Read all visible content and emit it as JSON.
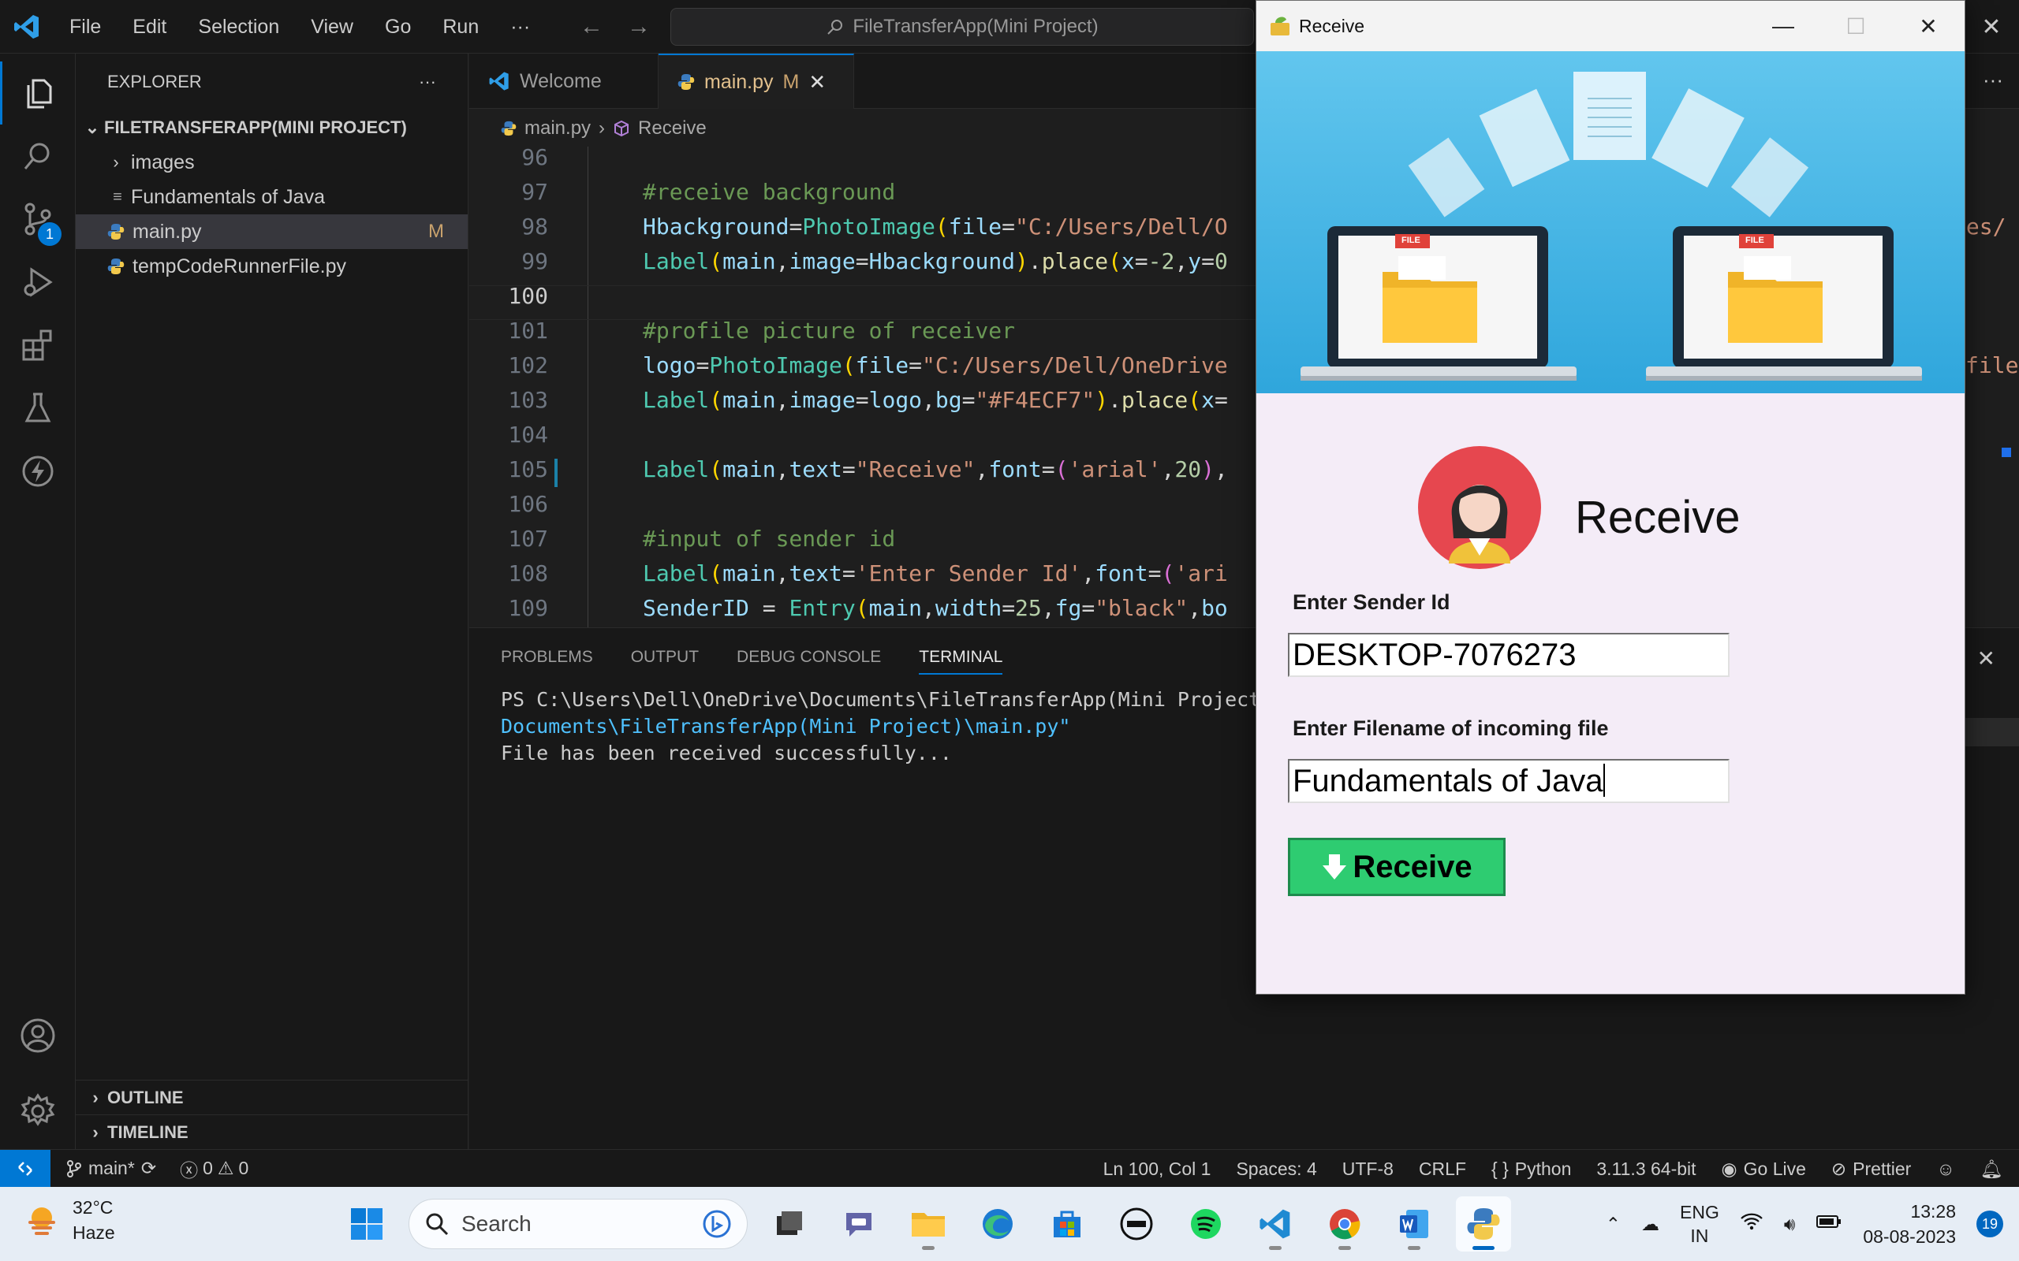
{
  "menu": [
    "File",
    "Edit",
    "Selection",
    "View",
    "Go",
    "Run"
  ],
  "menu_more": "···",
  "command_center": "FileTransferApp(Mini Project)",
  "explorer": {
    "title": "EXPLORER",
    "more": "···",
    "folder": "FILETRANSFERAPP(MINI PROJECT)",
    "items": [
      {
        "label": "images",
        "type": "folder"
      },
      {
        "label": "Fundamentals of Java",
        "type": "file"
      },
      {
        "label": "main.py",
        "type": "python",
        "flag": "M"
      },
      {
        "label": "tempCodeRunnerFile.py",
        "type": "python"
      }
    ],
    "outline": "OUTLINE",
    "timeline": "TIMELINE"
  },
  "activity_badge": "1",
  "tabs": [
    {
      "label": "Welcome"
    },
    {
      "label": "main.py",
      "flag": "M"
    }
  ],
  "breadcrumb": {
    "file": "main.py",
    "symbol": "Receive"
  },
  "code": {
    "line_numbers": [
      "96",
      "97",
      "98",
      "99",
      "100",
      "101",
      "102",
      "103",
      "104",
      "105",
      "106",
      "107",
      "108",
      "109"
    ],
    "current_line": "100",
    "lines": {
      "l97": "#receive background",
      "l98a": "Hbackground",
      "l98b": "PhotoImage",
      "l98c": "file",
      "l98d": "\"C:/Users/Dell/O",
      "l99a": "Label",
      "l99b": "main",
      "l99c": "image",
      "l99d": "Hbackground",
      "l99e": "place",
      "l99f": "x",
      "l99g": "-2",
      "l99h": "y",
      "l99i": "0",
      "l101": "#profile picture of receiver",
      "l102a": "logo",
      "l102b": "PhotoImage",
      "l102c": "file",
      "l102d": "\"C:/Users/Dell/OneDrive",
      "l103a": "Label",
      "l103b": "main",
      "l103c": "image",
      "l103d": "logo",
      "l103e": "bg",
      "l103f": "\"#F4ECF7\"",
      "l103g": "place",
      "l103h": "x",
      "l105a": "Label",
      "l105b": "main",
      "l105c": "text",
      "l105d": "\"Receive\"",
      "l105e": "font",
      "l105f": "'arial'",
      "l105g": "20",
      "l107": "#input of sender id",
      "l108a": "Label",
      "l108b": "main",
      "l108c": "text",
      "l108d": "'Enter Sender Id'",
      "l108e": "font",
      "l108f": "'ari",
      "l109a": "SenderID",
      "l109b": "Entry",
      "l109c": "main",
      "l109d": "width",
      "l109e": "25",
      "l109f": "fg",
      "l109g": "\"black\"",
      "l109h": "bo"
    },
    "right_fragments": [
      "ges/",
      "",
      "",
      "",
      "file"
    ]
  },
  "panel": {
    "tabs": [
      "PROBLEMS",
      "OUTPUT",
      "DEBUG CONSOLE",
      "TERMINAL"
    ],
    "active_tab": "TERMINAL",
    "terminal": {
      "line1": "PS C:\\Users\\Dell\\OneDrive\\Documents\\FileTransferApp(Mini Project",
      "line2": "Documents\\FileTransferApp(Mini Project)\\main.py\"",
      "line3": "File has been received successfully..."
    }
  },
  "status": {
    "branch": "main*",
    "errors": "0",
    "warnings": "0",
    "position": "Ln 100, Col 1",
    "spaces": "Spaces: 4",
    "encoding": "UTF-8",
    "eol": "CRLF",
    "language": "Python",
    "interpreter": "3.11.3 64-bit",
    "golive": "Go Live",
    "prettier": "Prettier"
  },
  "receive_window": {
    "title": "Receive",
    "heading": "Receive",
    "sender_label": "Enter Sender Id",
    "sender_value": "DESKTOP-7076273",
    "filename_label": "Enter Filename of incoming file",
    "filename_value": "Fundamentals of Java",
    "button_label": "Receive",
    "file_tag": "FILE"
  },
  "taskbar": {
    "temperature": "32°C",
    "weather": "Haze",
    "search_placeholder": "Search",
    "lang1": "ENG",
    "lang2": "IN",
    "time": "13:28",
    "date": "08-08-2023",
    "notifications": "19"
  }
}
